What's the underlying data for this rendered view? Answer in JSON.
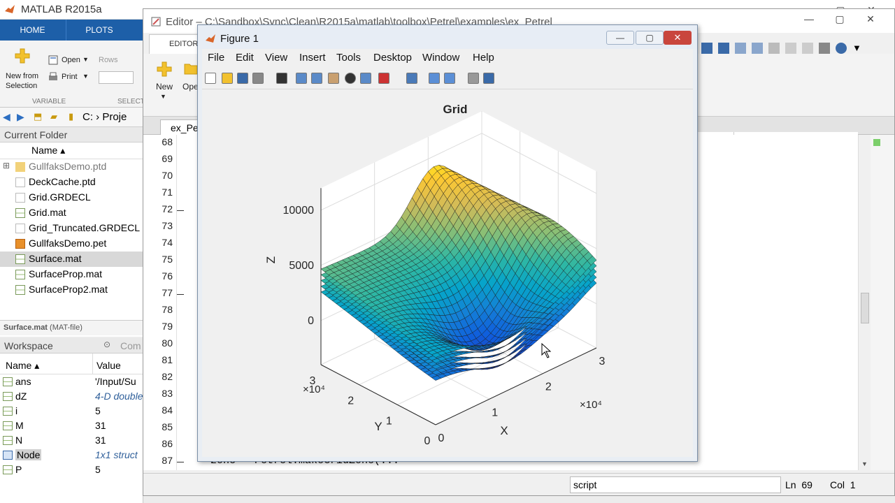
{
  "matlab": {
    "title": "MATLAB R2015a",
    "tabs": [
      "HOME",
      "PLOTS"
    ],
    "ribbon": {
      "new_from_selection": "New from\nSelection",
      "open": "Open",
      "print": "Print",
      "rows": "Rows",
      "variable_section": "VARIABLE",
      "selection_section": "SELECT"
    },
    "address": "C:  ›  Proje"
  },
  "current_folder": {
    "title": "Current Folder",
    "column_name": "Name ▴",
    "files": [
      {
        "name": "GullfaksDemo.ptd",
        "icon": "folder-icon",
        "muted": true
      },
      {
        "name": "DeckCache.ptd",
        "icon": "file-icon"
      },
      {
        "name": "Grid.GRDECL",
        "icon": "file-icon"
      },
      {
        "name": "Grid.mat",
        "icon": "mat-icon"
      },
      {
        "name": "Grid_Truncated.GRDECL",
        "icon": "file-icon"
      },
      {
        "name": "GullfaksDemo.pet",
        "icon": "petrel-icon"
      },
      {
        "name": "Surface.mat",
        "icon": "mat-icon",
        "selected": true
      },
      {
        "name": "SurfaceProp.mat",
        "icon": "mat-icon"
      },
      {
        "name": "SurfaceProp2.mat",
        "icon": "mat-icon"
      }
    ],
    "status": "Surface.mat",
    "status_type": "(MAT-file)"
  },
  "workspace": {
    "title": "Workspace",
    "other_tab": "Com",
    "col_name": "Name ▴",
    "col_value": "Value",
    "vars": [
      {
        "name": "ans",
        "value": "'/Input/Su",
        "italic": false,
        "icon": "abc"
      },
      {
        "name": "dZ",
        "value": "4-D double",
        "italic": true,
        "icon": "grid"
      },
      {
        "name": "i",
        "value": "5",
        "italic": false,
        "icon": "grid"
      },
      {
        "name": "M",
        "value": "31",
        "italic": false,
        "icon": "grid"
      },
      {
        "name": "N",
        "value": "31",
        "italic": false,
        "icon": "grid"
      },
      {
        "name": "Node",
        "value": "1x1 struct",
        "italic": true,
        "icon": "struct",
        "selected": true
      },
      {
        "name": "P",
        "value": "5",
        "italic": false,
        "icon": "grid"
      }
    ]
  },
  "editor": {
    "title": "Editor – C:\\Sandbox\\Sync\\Clean\\R2015a\\matlab\\toolbox\\Petrel\\examples\\ex_Petrel_Grid.m",
    "ribbon_tab": "EDITOR",
    "new_label": "New",
    "open_label": "Ope",
    "file_tab": "ex_Pe",
    "line_numbers": [
      "68",
      "69",
      "70",
      "71",
      "72",
      "73",
      "74",
      "75",
      "76",
      "77",
      "78",
      "79",
      "80",
      "81",
      "82",
      "83",
      "84",
      "85",
      "86",
      "87"
    ],
    "visible_code": "zone = Petrel.makeGridZone(...",
    "status_mode": "script",
    "status_ln_label": "Ln",
    "status_ln": "69",
    "status_col_label": "Col",
    "status_col": "1"
  },
  "figure": {
    "title": "Figure 1",
    "menus": [
      "File",
      "Edit",
      "View",
      "Insert",
      "Tools",
      "Desktop",
      "Window",
      "Help"
    ],
    "toolbar_icons": [
      "new-figure-icon",
      "open-icon",
      "save-icon",
      "print-icon",
      "pointer-icon",
      "zoom-in-icon",
      "zoom-out-icon",
      "pan-icon",
      "rotate-icon",
      "datacursor-icon",
      "brush-icon",
      "link-icon",
      "colorbar-icon",
      "legend-icon",
      "hide-plot-tools-icon",
      "show-plot-tools-icon"
    ]
  },
  "chart_data": {
    "type": "surface",
    "title": "Grid",
    "xlabel": "X",
    "ylabel": "Y",
    "zlabel": "Z",
    "x_ticks": [
      "0",
      "1",
      "2",
      "3"
    ],
    "y_ticks": [
      "0",
      "1",
      "2",
      "3"
    ],
    "z_ticks": [
      "0",
      "5000",
      "10000"
    ],
    "x_exponent": "×10⁴",
    "y_exponent": "×10⁴",
    "xlim": [
      0,
      30000
    ],
    "ylim": [
      0,
      30000
    ],
    "zlim": [
      -4000,
      12000
    ],
    "layers": 5,
    "grid": true,
    "colormap": "parula",
    "colors": [
      "#352a87",
      "#0f5cdd",
      "#1481d6",
      "#06a4ca",
      "#2eb7a4",
      "#87bf77",
      "#d1bb59",
      "#fec832",
      "#f9fb0e"
    ]
  }
}
